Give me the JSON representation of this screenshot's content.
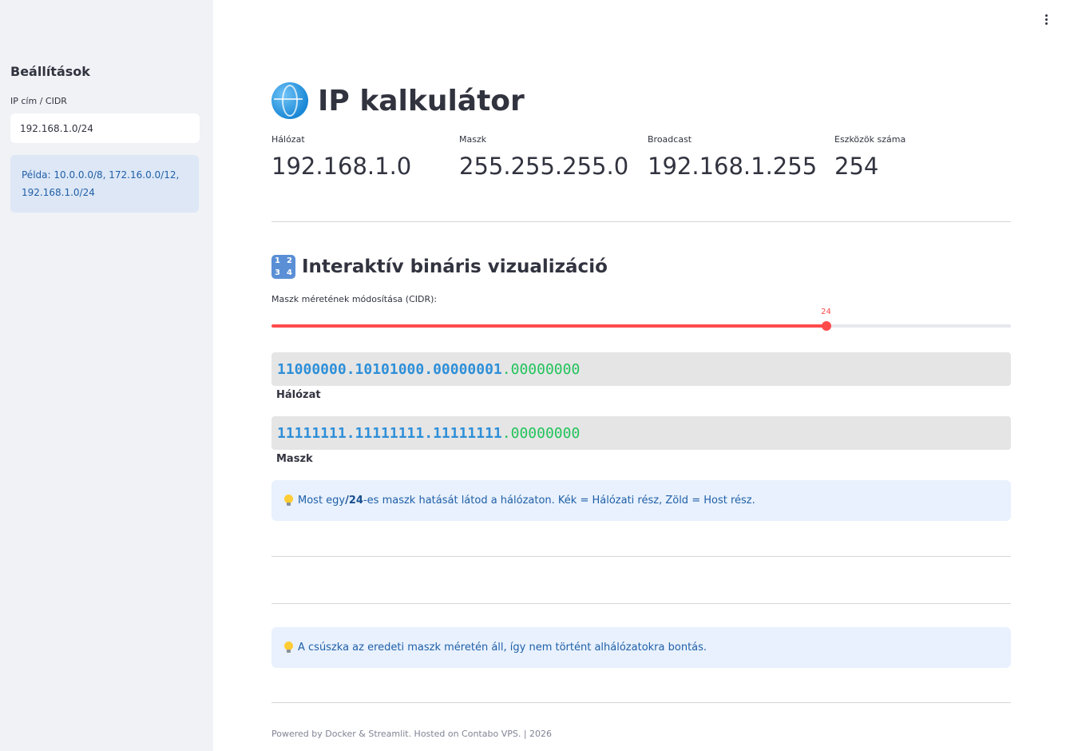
{
  "sidebar": {
    "title": "Beállítások",
    "ip_label": "IP cím / CIDR",
    "ip_value": "192.168.1.0/24",
    "hint": "Példa: 10.0.0.0/8, 172.16.0.0/12, 192.168.1.0/24"
  },
  "header": {
    "title": "IP kalkulátor",
    "title_icon": "globe-icon",
    "menu_icon": "kebab-menu-icon"
  },
  "metrics": [
    {
      "label": "Hálózat",
      "value": "192.168.1.0"
    },
    {
      "label": "Maszk",
      "value": "255.255.255.0"
    },
    {
      "label": "Broadcast",
      "value": "192.168.1.255"
    },
    {
      "label": "Eszközök száma",
      "value": "254"
    }
  ],
  "binary_section": {
    "title": "Interaktív bináris vizualizáció",
    "title_icon": "input-numbers-icon",
    "numbers_icon_glyphs": [
      "1",
      "2",
      "3",
      "4"
    ],
    "slider_label": "Maszk méretének módosítása (CIDR):",
    "slider": {
      "value": 24,
      "min": 0,
      "max": 32,
      "value_text": "24"
    },
    "network": {
      "net_part": "11000000.10101000.00000001",
      "host_part": ".00000000",
      "caption": "Hálózat"
    },
    "mask": {
      "net_part": "11111111.11111111.11111111",
      "host_part": ".00000000",
      "caption": "Maszk"
    },
    "info": {
      "prefix": "Most egy ",
      "bold": "/24",
      "suffix": "-es maszk hatását látod a hálózaton. Kék = Hálózati rész, Zöld = Host rész."
    }
  },
  "subnet_info": "A csúszka az eredeti maszk méretén áll, így nem történt alhálózatokra bontás.",
  "footer": "Powered by Docker & Streamlit. Hosted on Contabo VPS. | 2026",
  "colors": {
    "accent": "#ff4b4b",
    "network_bits": "#2e8fd8",
    "host_bits": "#21c35a",
    "info_bg": "#e8f1fd",
    "info_text": "#1f5fa8"
  }
}
